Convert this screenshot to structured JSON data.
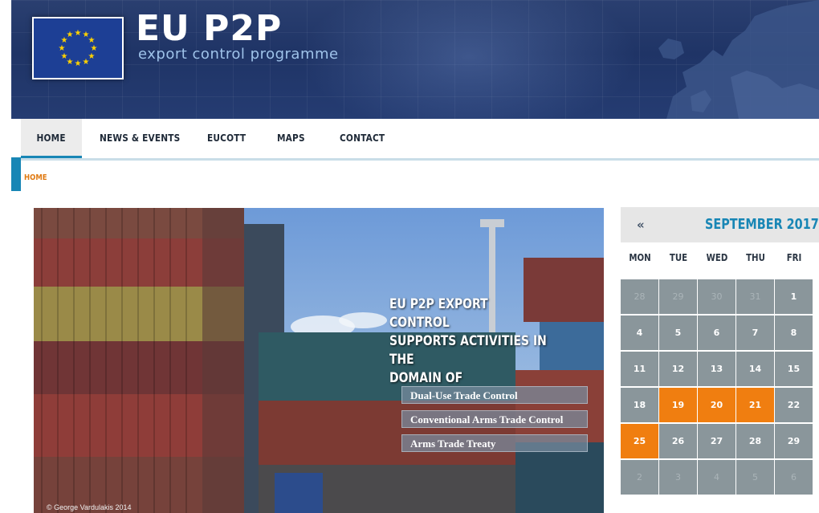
{
  "header": {
    "title": "EU P2P",
    "subtitle": "export control programme",
    "flag_icon": "eu-flag-icon"
  },
  "nav": {
    "items": [
      {
        "label": "HOME",
        "active": true
      },
      {
        "label": "NEWS & EVENTS",
        "active": false
      },
      {
        "label": "EUCOTT",
        "active": false
      },
      {
        "label": "MAPS",
        "active": false
      },
      {
        "label": "CONTACT",
        "active": false
      }
    ]
  },
  "breadcrumb": "HOME",
  "hero": {
    "heading_lines": [
      "EU P2P EXPORT CONTROL",
      "SUPPORTS ACTIVITIES IN THE",
      "DOMAIN OF"
    ],
    "links": [
      "Dual-Use Trade Control",
      "Conventional Arms Trade Control",
      "Arms Trade Treaty"
    ],
    "credit": "© George Vardulakis 2014"
  },
  "calendar": {
    "prev_icon": "«",
    "month": "SEPTEMBER 2017",
    "weekdays": [
      "MON",
      "TUE",
      "WED",
      "THU",
      "FRI"
    ],
    "weeks": [
      [
        "28",
        "29",
        "30",
        "31",
        "1"
      ],
      [
        "4",
        "5",
        "6",
        "7",
        "8"
      ],
      [
        "11",
        "12",
        "13",
        "14",
        "15"
      ],
      [
        "18",
        "19",
        "20",
        "21",
        "22"
      ],
      [
        "25",
        "26",
        "27",
        "28",
        "29"
      ],
      [
        "2",
        "3",
        "4",
        "5",
        "6"
      ]
    ],
    "event_days": [
      "19",
      "20",
      "21",
      "25"
    ],
    "colors": {
      "accent": "#1886b5",
      "event": "#f07e10",
      "day": "#8a969b"
    }
  }
}
